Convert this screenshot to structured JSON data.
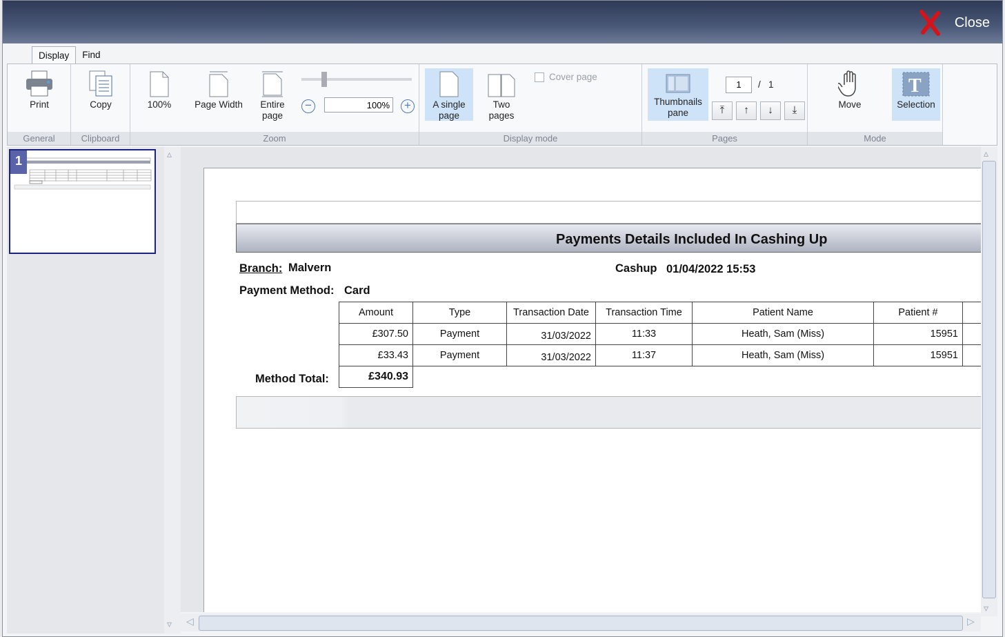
{
  "window": {
    "close_label": "Close"
  },
  "tabs": [
    "Display",
    "Find"
  ],
  "ribbon": {
    "general": {
      "label": "General",
      "print": "Print"
    },
    "clipboard": {
      "label": "Clipboard",
      "copy": "Copy"
    },
    "zoom": {
      "label": "Zoom",
      "z100": "100%",
      "page_width": "Page Width",
      "entire_line1": "Entire",
      "entire_line2": "page",
      "value": "100%",
      "minus": "−",
      "plus": "+",
      "slider_fraction": 0.19
    },
    "display_mode": {
      "label": "Display mode",
      "single_line1": "A single",
      "single_line2": "page",
      "two_line1": "Two",
      "two_line2": "pages",
      "cover": "Cover page"
    },
    "pages": {
      "label": "Pages",
      "thumbs_line1": "Thumbnails",
      "thumbs_line2": "pane",
      "current": "1",
      "separator": "/",
      "total": "1",
      "first": "⤒",
      "prev": "↑",
      "next": "↓",
      "last": "⤓"
    },
    "mode": {
      "label": "Mode",
      "move": "Move",
      "selection": "Selection"
    }
  },
  "thumbnail": {
    "number": "1"
  },
  "report": {
    "title": "Payments Details Included In Cashing Up",
    "branch_label": "Branch:",
    "branch_value": "Malvern",
    "cashup_label": "Cashup",
    "cashup_value": "01/04/2022 15:53",
    "method_label": "Payment Method:",
    "method_value": "Card",
    "columns": [
      "Amount",
      "Type",
      "Transaction Date",
      "Transaction Time",
      "Patient Name",
      "Patient #"
    ],
    "rows": [
      [
        "£307.50",
        "Payment",
        "31/03/2022",
        "11:33",
        "Heath, Sam (Miss)",
        "15951"
      ],
      [
        "£33.43",
        "Payment",
        "31/03/2022",
        "11:37",
        "Heath, Sam (Miss)",
        "15951"
      ]
    ],
    "total_label": "Method Total:",
    "total_value": "£340.93"
  }
}
